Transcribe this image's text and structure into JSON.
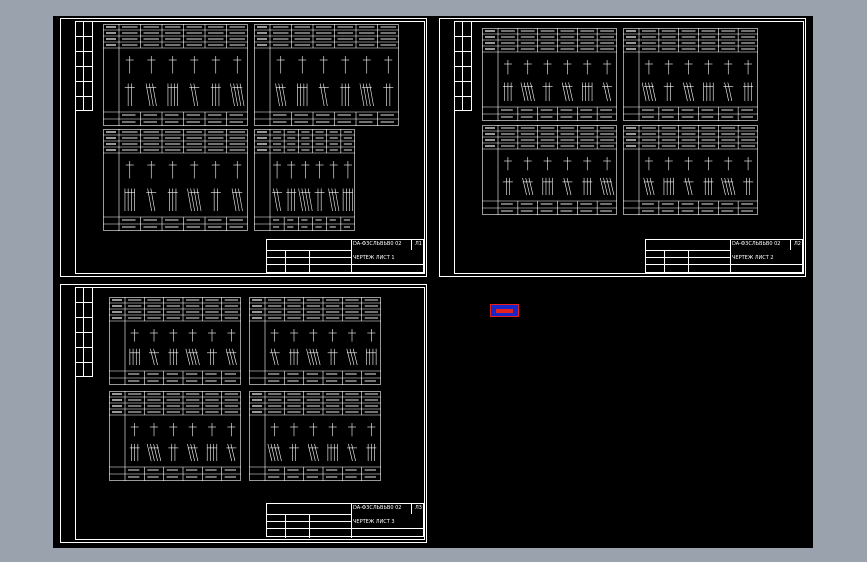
{
  "drawing": {
    "sheets": [
      {
        "drawing_number": "DA-Ф3СЛЬВЬВ0 02",
        "title": "ЧЕРТЕЖ ЛИСТ 1",
        "sheet_label": "Л1"
      },
      {
        "drawing_number": "DA-Ф3СЛЬВЬВ0 02",
        "title": "ЧЕРТЕЖ ЛИСТ 2",
        "sheet_label": "Л2"
      },
      {
        "drawing_number": "DA-Ф3СЛЬВЬВ0 02",
        "title": "ЧЕРТЕЖ ЛИСТ 3",
        "sheet_label": "Л3"
      }
    ]
  },
  "colors": {
    "background": "#000000",
    "frame": "#ffffff",
    "outer": "#9aa3ad",
    "selection_fill": "#1726c8",
    "selection_edge": "#e62020"
  }
}
